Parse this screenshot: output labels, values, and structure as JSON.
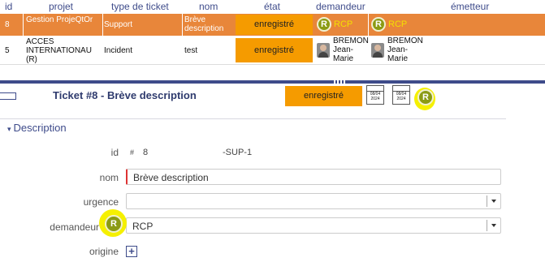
{
  "table": {
    "headers": [
      "id",
      "projet",
      "type de ticket",
      "nom",
      "état",
      "demandeur",
      "émetteur"
    ],
    "rows": [
      {
        "id": "8",
        "projet": "Gestion ProjeQtOr",
        "type": "Support",
        "nom": "Brève description",
        "etat": "enregistré",
        "demandeur_initial": "R",
        "demandeur": "RCP",
        "emetteur_initial": "R",
        "emetteur": "RCP"
      },
      {
        "id": "5",
        "projet": "ACCES INTERNATIONAU (R)",
        "type": "Incident",
        "nom": "test",
        "etat": "enregistré",
        "demandeur": "BREMON Jean-Marie",
        "emetteur": "BREMON Jean-Marie"
      }
    ]
  },
  "ticket": {
    "title": "Ticket  #8  - Brève description",
    "state": "enregistré",
    "calendar_dates": [
      "08/04 2024",
      "08/04 2024"
    ],
    "owner_initial": "R"
  },
  "section": {
    "title": "Description"
  },
  "form": {
    "id_label": "id",
    "id_hash": "#",
    "id_value": "8",
    "id_suffix": "-SUP-1",
    "nom_label": "nom",
    "nom_value": "Brève description",
    "urgence_label": "urgence",
    "urgence_value": "",
    "demandeur_label": "demandeur",
    "demandeur_initial": "R",
    "demandeur_value": "RCP",
    "origine_label": "origine",
    "origine_add": "+"
  },
  "colors": {
    "header_text": "#3e4b8a",
    "selected_row": "#e8863a",
    "state_bg": "#f59b00",
    "highlight": "#f5f000",
    "badge_green": "#8b9b14"
  },
  "icons": [
    "toggle-panel-icon",
    "calendar-icon",
    "avatar-icon",
    "dropdown-arrow-icon",
    "add-icon",
    "collapse-triangle-icon"
  ]
}
